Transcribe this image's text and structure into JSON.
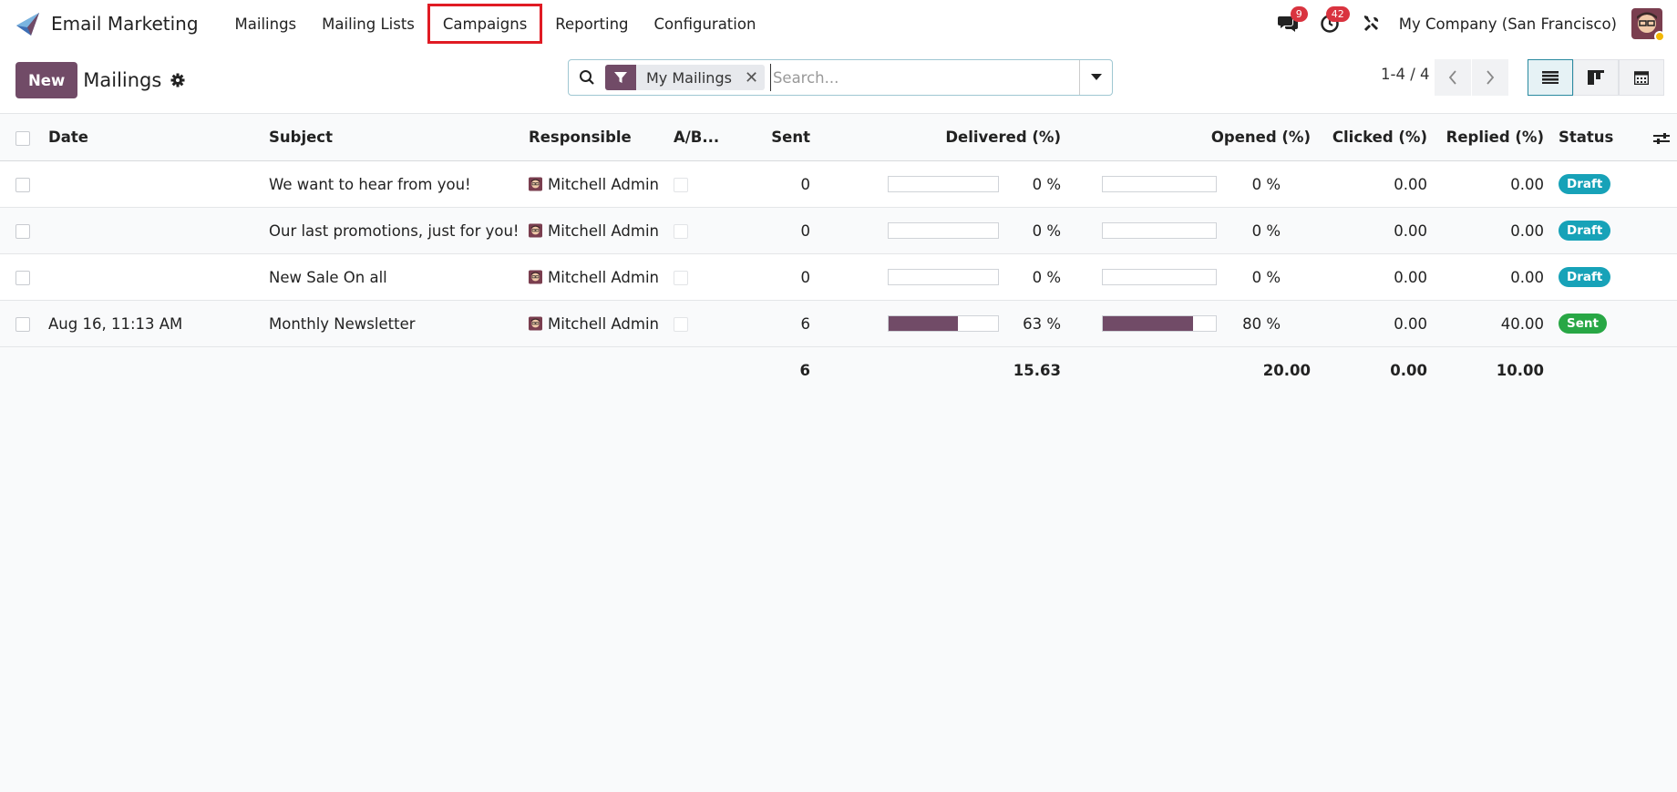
{
  "navbar": {
    "app_name": "Email Marketing",
    "menu": [
      "Mailings",
      "Mailing Lists",
      "Campaigns",
      "Reporting",
      "Configuration"
    ],
    "messages_count": "9",
    "activities_count": "42",
    "company": "My Company (San Francisco)"
  },
  "control": {
    "new_label": "New",
    "title": "Mailings",
    "facet_label": "My Mailings",
    "search_placeholder": "Search...",
    "pager": "1-4 / 4"
  },
  "table": {
    "headers": {
      "date": "Date",
      "subject": "Subject",
      "responsible": "Responsible",
      "ab": "A/B...",
      "sent": "Sent",
      "delivered": "Delivered (%)",
      "opened": "Opened (%)",
      "clicked": "Clicked (%)",
      "replied": "Replied (%)",
      "status": "Status"
    },
    "rows": [
      {
        "date": "",
        "subject": "We want to hear from you!",
        "responsible": "Mitchell Admin",
        "sent": "0",
        "delivered_pct": 0,
        "delivered": "0 %",
        "opened_pct": 0,
        "opened": "0 %",
        "clicked": "0.00",
        "replied": "0.00",
        "status": "Draft"
      },
      {
        "date": "",
        "subject": "Our last promotions, just for you!",
        "responsible": "Mitchell Admin",
        "sent": "0",
        "delivered_pct": 0,
        "delivered": "0 %",
        "opened_pct": 0,
        "opened": "0 %",
        "clicked": "0.00",
        "replied": "0.00",
        "status": "Draft"
      },
      {
        "date": "",
        "subject": "New Sale On all",
        "responsible": "Mitchell Admin",
        "sent": "0",
        "delivered_pct": 0,
        "delivered": "0 %",
        "opened_pct": 0,
        "opened": "0 %",
        "clicked": "0.00",
        "replied": "0.00",
        "status": "Draft"
      },
      {
        "date": "Aug 16, 11:13 AM",
        "subject": "Monthly Newsletter",
        "responsible": "Mitchell Admin",
        "sent": "6",
        "delivered_pct": 63,
        "delivered": "63 %",
        "opened_pct": 80,
        "opened": "80 %",
        "clicked": "0.00",
        "replied": "40.00",
        "status": "Sent"
      }
    ],
    "totals": {
      "sent": "6",
      "delivered": "15.63",
      "opened": "20.00",
      "clicked": "0.00",
      "replied": "10.00"
    }
  },
  "colors": {
    "brand": "#714b67",
    "draft": "#17a2b8",
    "sent": "#28a745",
    "highlight": "#e01b24"
  }
}
